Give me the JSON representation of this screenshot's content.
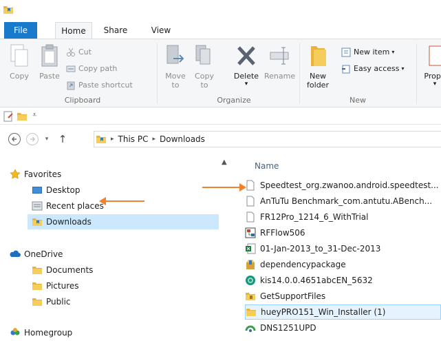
{
  "ribbon_tabs": {
    "file": "File",
    "home": "Home",
    "share": "Share",
    "view": "View"
  },
  "clipboard": {
    "copy": "Copy",
    "paste": "Paste",
    "cut": "Cut",
    "copy_path": "Copy path",
    "paste_shortcut": "Paste shortcut",
    "label": "Clipboard"
  },
  "organize": {
    "move_to": "Move",
    "move_to_2": "to",
    "copy_to": "Copy",
    "copy_to_2": "to",
    "delete": "Delete",
    "rename": "Rename",
    "label": "Organize"
  },
  "new_group": {
    "new_folder": "New",
    "new_folder_2": "folder",
    "new_item": "New item",
    "easy_access": "Easy access",
    "label": "New"
  },
  "open_group": {
    "properties": "Prope"
  },
  "address": {
    "crumb_1": "This PC",
    "crumb_2": "Downloads"
  },
  "nav": {
    "favorites": "Favorites",
    "desktop": "Desktop",
    "recent_places": "Recent places",
    "downloads": "Downloads",
    "onedrive": "OneDrive",
    "documents": "Documents",
    "pictures": "Pictures",
    "public": "Public",
    "homegroup": "Homegroup"
  },
  "files": {
    "column_name": "Name",
    "rows": [
      {
        "name": "Speedtest_org.zwanoo.android.speedtest...",
        "icon": "blank-file-icon"
      },
      {
        "name": "AnTuTu Benchmark_com.antutu.ABench...",
        "icon": "blank-file-icon"
      },
      {
        "name": "FR12Pro_1214_6_WithTrial",
        "icon": "blank-file-icon"
      },
      {
        "name": "RFFlow506",
        "icon": "rfflow-app-icon"
      },
      {
        "name": "01-Jan-2013_to_31-Dec-2013",
        "icon": "excel-file-icon"
      },
      {
        "name": "dependencypackage",
        "icon": "package-icon"
      },
      {
        "name": "kis14.0.0.4651abcEN_5632",
        "icon": "kaspersky-icon"
      },
      {
        "name": "GetSupportFiles",
        "icon": "folder-icon"
      },
      {
        "name": "hueyPRO151_Win_Installer (1)",
        "icon": "folder-icon"
      },
      {
        "name": "DNS1251UPD",
        "icon": "dns-app-icon"
      }
    ]
  },
  "colors": {
    "accent": "#1979ca",
    "arrow": "#f0822d",
    "selection": "#cce8ff"
  }
}
